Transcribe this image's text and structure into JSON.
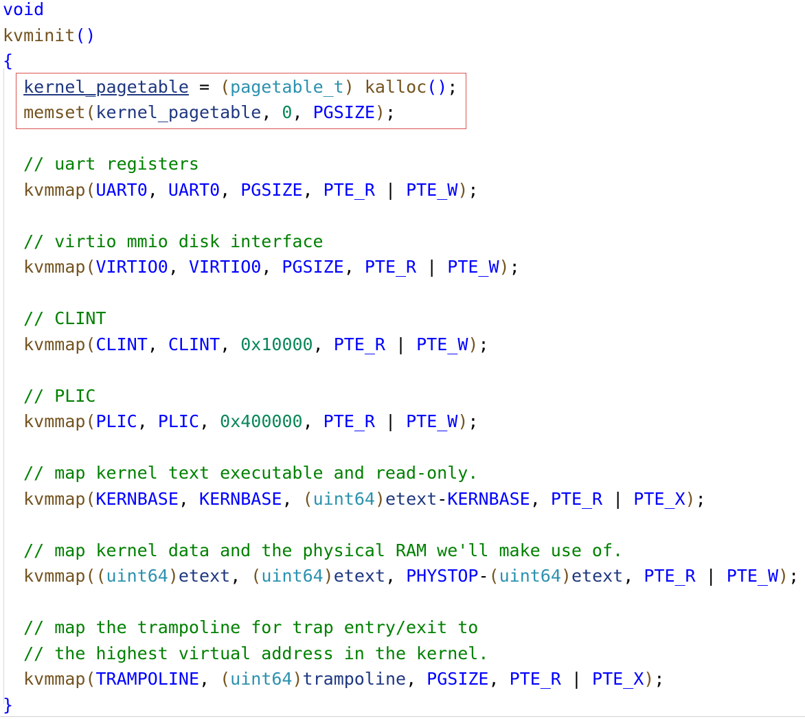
{
  "editor": {
    "highlight_note": "",
    "lines": [
      [
        {
          "t": "void",
          "c": "kw"
        }
      ],
      [
        {
          "t": "kvminit",
          "c": "fn"
        },
        {
          "t": "()",
          "c": "kw"
        }
      ],
      [
        {
          "t": "{",
          "c": "kw"
        }
      ],
      [
        {
          "t": "  ",
          "c": "p"
        },
        {
          "t": "kernel_pagetable",
          "c": "gvar"
        },
        {
          "t": " = ",
          "c": "p"
        },
        {
          "t": "(",
          "c": "fn"
        },
        {
          "t": "pagetable_t",
          "c": "type"
        },
        {
          "t": ")",
          "c": "fn"
        },
        {
          "t": " ",
          "c": "p"
        },
        {
          "t": "kalloc",
          "c": "fn"
        },
        {
          "t": "()",
          "c": "kw"
        },
        {
          "t": ";",
          "c": "p"
        }
      ],
      [
        {
          "t": "  ",
          "c": "p"
        },
        {
          "t": "memset",
          "c": "fn"
        },
        {
          "t": "(",
          "c": "fn"
        },
        {
          "t": "kernel_pagetable",
          "c": "var"
        },
        {
          "t": ", ",
          "c": "p"
        },
        {
          "t": "0",
          "c": "num"
        },
        {
          "t": ", ",
          "c": "p"
        },
        {
          "t": "PGSIZE",
          "c": "macro"
        },
        {
          "t": ")",
          "c": "fn"
        },
        {
          "t": ";",
          "c": "p"
        }
      ],
      [],
      [
        {
          "t": "  // uart registers",
          "c": "cmt"
        }
      ],
      [
        {
          "t": "  ",
          "c": "p"
        },
        {
          "t": "kvmmap",
          "c": "fn"
        },
        {
          "t": "(",
          "c": "fn"
        },
        {
          "t": "UART0",
          "c": "macro"
        },
        {
          "t": ", ",
          "c": "p"
        },
        {
          "t": "UART0",
          "c": "macro"
        },
        {
          "t": ", ",
          "c": "p"
        },
        {
          "t": "PGSIZE",
          "c": "macro"
        },
        {
          "t": ", ",
          "c": "p"
        },
        {
          "t": "PTE_R",
          "c": "macro"
        },
        {
          "t": " | ",
          "c": "p"
        },
        {
          "t": "PTE_W",
          "c": "macro"
        },
        {
          "t": ")",
          "c": "fn"
        },
        {
          "t": ";",
          "c": "p"
        }
      ],
      [],
      [
        {
          "t": "  // virtio mmio disk interface",
          "c": "cmt"
        }
      ],
      [
        {
          "t": "  ",
          "c": "p"
        },
        {
          "t": "kvmmap",
          "c": "fn"
        },
        {
          "t": "(",
          "c": "fn"
        },
        {
          "t": "VIRTIO0",
          "c": "macro"
        },
        {
          "t": ", ",
          "c": "p"
        },
        {
          "t": "VIRTIO0",
          "c": "macro"
        },
        {
          "t": ", ",
          "c": "p"
        },
        {
          "t": "PGSIZE",
          "c": "macro"
        },
        {
          "t": ", ",
          "c": "p"
        },
        {
          "t": "PTE_R",
          "c": "macro"
        },
        {
          "t": " | ",
          "c": "p"
        },
        {
          "t": "PTE_W",
          "c": "macro"
        },
        {
          "t": ")",
          "c": "fn"
        },
        {
          "t": ";",
          "c": "p"
        }
      ],
      [],
      [
        {
          "t": "  // CLINT",
          "c": "cmt"
        }
      ],
      [
        {
          "t": "  ",
          "c": "p"
        },
        {
          "t": "kvmmap",
          "c": "fn"
        },
        {
          "t": "(",
          "c": "fn"
        },
        {
          "t": "CLINT",
          "c": "macro"
        },
        {
          "t": ", ",
          "c": "p"
        },
        {
          "t": "CLINT",
          "c": "macro"
        },
        {
          "t": ", ",
          "c": "p"
        },
        {
          "t": "0x10000",
          "c": "num"
        },
        {
          "t": ", ",
          "c": "p"
        },
        {
          "t": "PTE_R",
          "c": "macro"
        },
        {
          "t": " | ",
          "c": "p"
        },
        {
          "t": "PTE_W",
          "c": "macro"
        },
        {
          "t": ")",
          "c": "fn"
        },
        {
          "t": ";",
          "c": "p"
        }
      ],
      [],
      [
        {
          "t": "  // PLIC",
          "c": "cmt"
        }
      ],
      [
        {
          "t": "  ",
          "c": "p"
        },
        {
          "t": "kvmmap",
          "c": "fn"
        },
        {
          "t": "(",
          "c": "fn"
        },
        {
          "t": "PLIC",
          "c": "macro"
        },
        {
          "t": ", ",
          "c": "p"
        },
        {
          "t": "PLIC",
          "c": "macro"
        },
        {
          "t": ", ",
          "c": "p"
        },
        {
          "t": "0x400000",
          "c": "num"
        },
        {
          "t": ", ",
          "c": "p"
        },
        {
          "t": "PTE_R",
          "c": "macro"
        },
        {
          "t": " | ",
          "c": "p"
        },
        {
          "t": "PTE_W",
          "c": "macro"
        },
        {
          "t": ")",
          "c": "fn"
        },
        {
          "t": ";",
          "c": "p"
        }
      ],
      [],
      [
        {
          "t": "  // map kernel text executable and read-only.",
          "c": "cmt"
        }
      ],
      [
        {
          "t": "  ",
          "c": "p"
        },
        {
          "t": "kvmmap",
          "c": "fn"
        },
        {
          "t": "(",
          "c": "fn"
        },
        {
          "t": "KERNBASE",
          "c": "macro"
        },
        {
          "t": ", ",
          "c": "p"
        },
        {
          "t": "KERNBASE",
          "c": "macro"
        },
        {
          "t": ", ",
          "c": "p"
        },
        {
          "t": "(",
          "c": "fn"
        },
        {
          "t": "uint64",
          "c": "type"
        },
        {
          "t": ")",
          "c": "fn"
        },
        {
          "t": "etext",
          "c": "var"
        },
        {
          "t": "-",
          "c": "p"
        },
        {
          "t": "KERNBASE",
          "c": "macro"
        },
        {
          "t": ", ",
          "c": "p"
        },
        {
          "t": "PTE_R",
          "c": "macro"
        },
        {
          "t": " | ",
          "c": "p"
        },
        {
          "t": "PTE_X",
          "c": "macro"
        },
        {
          "t": ")",
          "c": "fn"
        },
        {
          "t": ";",
          "c": "p"
        }
      ],
      [],
      [
        {
          "t": "  // map kernel data and the physical RAM we'll make use of.",
          "c": "cmt"
        }
      ],
      [
        {
          "t": "  ",
          "c": "p"
        },
        {
          "t": "kvmmap",
          "c": "fn"
        },
        {
          "t": "(",
          "c": "fn"
        },
        {
          "t": "(",
          "c": "fn"
        },
        {
          "t": "uint64",
          "c": "type"
        },
        {
          "t": ")",
          "c": "fn"
        },
        {
          "t": "etext",
          "c": "var"
        },
        {
          "t": ", ",
          "c": "p"
        },
        {
          "t": "(",
          "c": "fn"
        },
        {
          "t": "uint64",
          "c": "type"
        },
        {
          "t": ")",
          "c": "fn"
        },
        {
          "t": "etext",
          "c": "var"
        },
        {
          "t": ", ",
          "c": "p"
        },
        {
          "t": "PHYSTOP",
          "c": "macro"
        },
        {
          "t": "-",
          "c": "p"
        },
        {
          "t": "(",
          "c": "fn"
        },
        {
          "t": "uint64",
          "c": "type"
        },
        {
          "t": ")",
          "c": "fn"
        },
        {
          "t": "etext",
          "c": "var"
        },
        {
          "t": ", ",
          "c": "p"
        },
        {
          "t": "PTE_R",
          "c": "macro"
        },
        {
          "t": " | ",
          "c": "p"
        },
        {
          "t": "PTE_W",
          "c": "macro"
        },
        {
          "t": ")",
          "c": "fn"
        },
        {
          "t": ";",
          "c": "p"
        }
      ],
      [],
      [
        {
          "t": "  // map the trampoline for trap entry/exit to",
          "c": "cmt"
        }
      ],
      [
        {
          "t": "  // the highest virtual address in the kernel.",
          "c": "cmt"
        }
      ],
      [
        {
          "t": "  ",
          "c": "p"
        },
        {
          "t": "kvmmap",
          "c": "fn"
        },
        {
          "t": "(",
          "c": "fn"
        },
        {
          "t": "TRAMPOLINE",
          "c": "macro"
        },
        {
          "t": ", ",
          "c": "p"
        },
        {
          "t": "(",
          "c": "fn"
        },
        {
          "t": "uint64",
          "c": "type"
        },
        {
          "t": ")",
          "c": "fn"
        },
        {
          "t": "trampoline",
          "c": "var"
        },
        {
          "t": ", ",
          "c": "p"
        },
        {
          "t": "PGSIZE",
          "c": "macro"
        },
        {
          "t": ", ",
          "c": "p"
        },
        {
          "t": "PTE_R",
          "c": "macro"
        },
        {
          "t": " | ",
          "c": "p"
        },
        {
          "t": "PTE_X",
          "c": "macro"
        },
        {
          "t": ")",
          "c": "fn"
        },
        {
          "t": ";",
          "c": "p"
        }
      ],
      [
        {
          "t": "}",
          "c": "kw"
        }
      ]
    ]
  }
}
